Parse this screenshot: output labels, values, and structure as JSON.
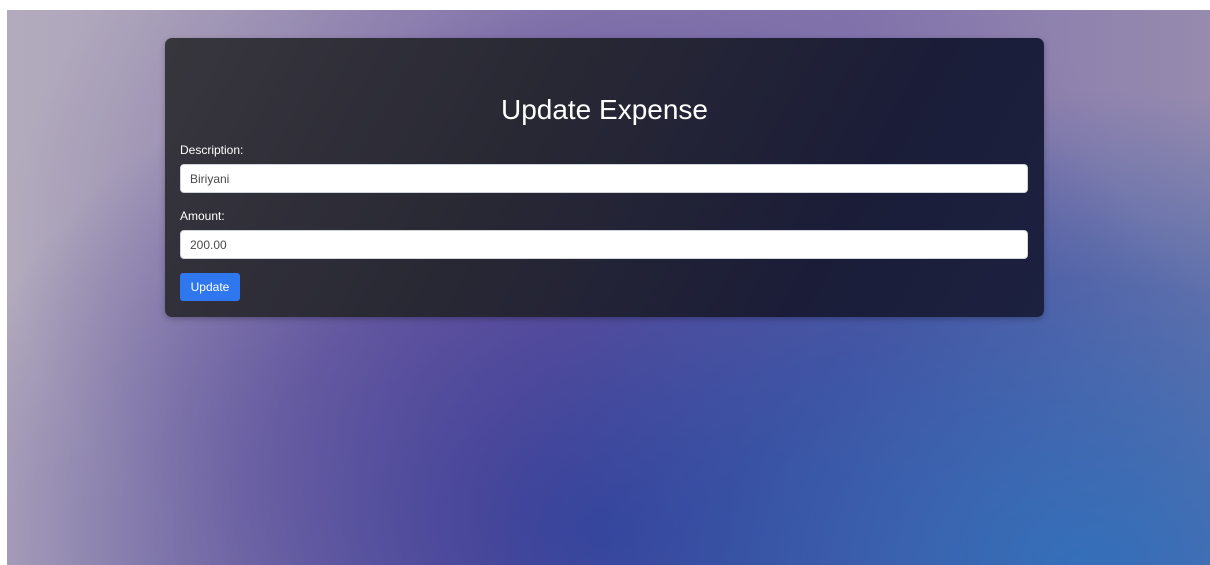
{
  "form": {
    "title": "Update Expense",
    "description_label": "Description:",
    "description_value": "Biriyani",
    "amount_label": "Amount:",
    "amount_value": "200.00",
    "submit_label": "Update"
  },
  "colors": {
    "button": "#2f77ee",
    "card": "#242433"
  }
}
